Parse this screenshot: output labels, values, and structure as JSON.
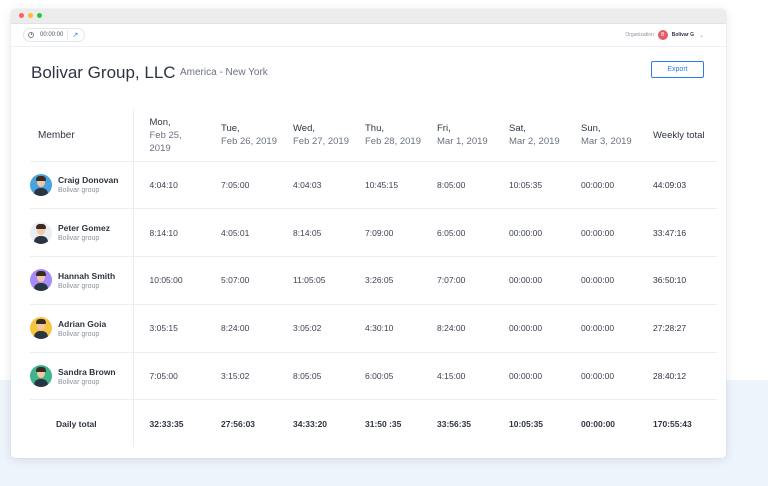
{
  "toolbar": {
    "timer": "00:00:00",
    "organization_label": "Organization",
    "org_avatar_letter": "B",
    "org_name": "Bolivar G"
  },
  "header": {
    "company": "Bolivar Group, LLC",
    "location": "America - New York",
    "export_label": "Export"
  },
  "table": {
    "member_header": "Member",
    "weekly_header": "Weekly total",
    "days": [
      {
        "day": "Mon,",
        "date": "Feb 25, 2019"
      },
      {
        "day": "Tue,",
        "date": "Feb 26, 2019"
      },
      {
        "day": "Wed,",
        "date": "Feb 27, 2019"
      },
      {
        "day": "Thu,",
        "date": "Feb 28, 2019"
      },
      {
        "day": "Fri,",
        "date": "Mar 1, 2019"
      },
      {
        "day": "Sat,",
        "date": "Mar 2, 2019"
      },
      {
        "day": "Sun,",
        "date": "Mar 3, 2019"
      }
    ],
    "rows": [
      {
        "name": "Craig Donovan",
        "group": "Bolivar group",
        "avatar_color": "#4aa3df",
        "times": [
          "4:04:10",
          "7:05:00",
          "4:04:03",
          "10:45:15",
          "8:05:00",
          "10:05:35",
          "00:00:00"
        ],
        "total": "44:09:03"
      },
      {
        "name": "Peter Gomez",
        "group": "Bolivar group",
        "avatar_color": "#e9edf2",
        "times": [
          "8:14:10",
          "4:05:01",
          "8:14:05",
          "7:09:00",
          "6:05:00",
          "00:00:00",
          "00:00:00"
        ],
        "total": "33:47:16"
      },
      {
        "name": "Hannah Smith",
        "group": "Bolivar group",
        "avatar_color": "#a78bfa",
        "times": [
          "10:05:00",
          "5:07:00",
          "11:05:05",
          "3:26:05",
          "7:07:00",
          "00:00:00",
          "00:00:00"
        ],
        "total": "36:50:10"
      },
      {
        "name": "Adrian Goia",
        "group": "Bolivar group",
        "avatar_color": "#f5c542",
        "times": [
          "3:05:15",
          "8:24:00",
          "3:05:02",
          "4:30:10",
          "8:24:00",
          "00:00:00",
          "00:00:00"
        ],
        "total": "27:28:27"
      },
      {
        "name": "Sandra Brown",
        "group": "Bolivar group",
        "avatar_color": "#3fb58c",
        "times": [
          "7:05:00",
          "3:15:02",
          "8:05:05",
          "6:00:05",
          "4:15:00",
          "00:00:00",
          "00:00:00"
        ],
        "total": "28:40:12"
      }
    ],
    "daily_label": "Daily total",
    "daily_totals": [
      "32:33:35",
      "27:56:03",
      "34:33:20",
      "31:50 :35",
      "33:56:35",
      "10:05:35",
      "00:00:00"
    ],
    "grand_total": "170:55:43"
  },
  "colors": {
    "accent": "#2b7de9",
    "org_avatar": "#e45b6a"
  }
}
